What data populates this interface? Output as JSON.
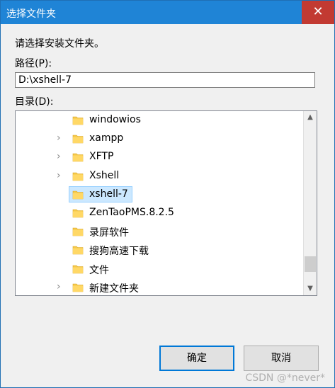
{
  "window": {
    "title": "选择文件夹",
    "close_glyph": "✕"
  },
  "prompt": "请选择安装文件夹。",
  "path": {
    "label": "路径(P):",
    "value": "D:\\xshell-7"
  },
  "tree": {
    "label": "目录(D):",
    "items": [
      {
        "name": "windowios",
        "expandable": false,
        "selected": false
      },
      {
        "name": "xampp",
        "expandable": true,
        "selected": false
      },
      {
        "name": "XFTP",
        "expandable": true,
        "selected": false
      },
      {
        "name": "Xshell",
        "expandable": true,
        "selected": false
      },
      {
        "name": "xshell-7",
        "expandable": false,
        "selected": true
      },
      {
        "name": "ZenTaoPMS.8.2.5",
        "expandable": false,
        "selected": false
      },
      {
        "name": "录屏软件",
        "expandable": false,
        "selected": false
      },
      {
        "name": "搜狗高速下载",
        "expandable": false,
        "selected": false
      },
      {
        "name": "文件",
        "expandable": false,
        "selected": false
      },
      {
        "name": "新建文件夹",
        "expandable": true,
        "selected": false
      }
    ],
    "expander_glyph": "›"
  },
  "buttons": {
    "ok": "确定",
    "cancel": "取消"
  },
  "watermark": "CSDN @*never*",
  "colors": {
    "titlebar": "#1f84d6",
    "close": "#c23a32",
    "selection": "#cce8ff",
    "folder": "#f5c94a",
    "default_button_border": "#0078d7"
  },
  "icons": {
    "folder": "folder-icon",
    "expander": "chevron-right-icon",
    "close": "close-icon",
    "scroll_up": "arrow-up-icon",
    "scroll_down": "arrow-down-icon"
  }
}
